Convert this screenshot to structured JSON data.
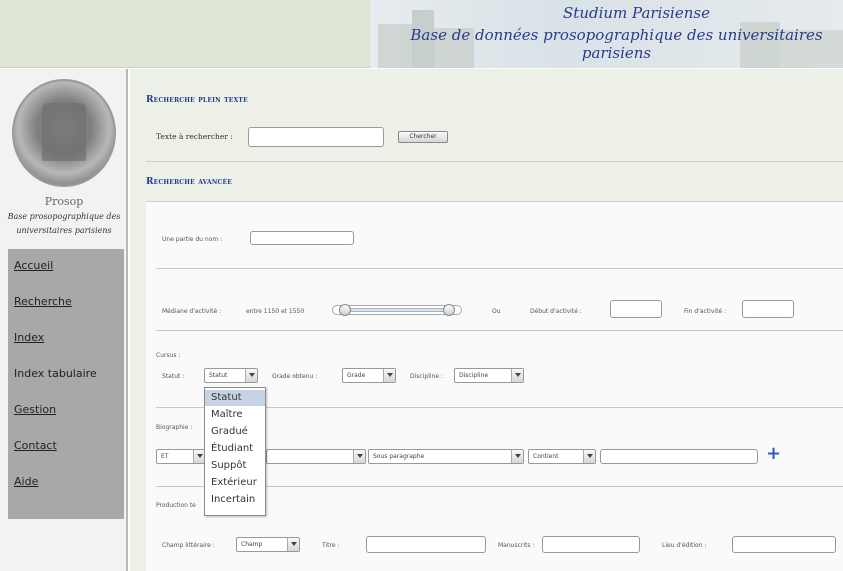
{
  "header": {
    "title": "Studium Parisiense",
    "subtitle": "Base de données prosopographique des universitaires parisiens"
  },
  "sidebar": {
    "seal_text": "Prosop",
    "description": "Base prosopographique des universitaires parisiens",
    "nav": [
      {
        "label": "Accueil"
      },
      {
        "label": "Recherche"
      },
      {
        "label": "Index"
      },
      {
        "label": "Index tabulaire"
      },
      {
        "label": "Gestion"
      },
      {
        "label": "Contact"
      },
      {
        "label": "Aide"
      }
    ]
  },
  "fulltext": {
    "title": "Recherche plein texte",
    "label": "Texte à rechercher :",
    "button": "Chercher"
  },
  "advanced": {
    "title": "Recherche avancée",
    "name_label": "Une partie du nom :",
    "median_label": "Médiane d'activité :",
    "median_range": "entre 1150 et 1550",
    "or_label": "Ou",
    "start_label": "Début d'activité :",
    "end_label": "Fin d'activité :",
    "cursus_label": "Cursus :",
    "statut_label": "Statut :",
    "statut_value": "Statut",
    "grade_label": "Grade obtenu :",
    "grade_value": "Grade",
    "discipline_label": "Discipline :",
    "discipline_value": "Discipline",
    "bio_label": "Biographie :",
    "bio_op": "ET",
    "bio_sub": "Sous paragraphe",
    "bio_cond": "Contient",
    "production_label": "Production te",
    "champ_label": "Champ littéraire :",
    "champ_value": "Champ",
    "titre_label": "Titre :",
    "manuscrits_label": "Manuscrits :",
    "lieu_label": "Lieu d'édition :"
  },
  "statut_dropdown": {
    "options": [
      "Statut",
      "Maître",
      "Gradué",
      "Étudiant",
      "Suppôt",
      "Extérieur",
      "Incertain"
    ],
    "selected": "Statut",
    "highlight_color": "#c6d3e3"
  },
  "colors": {
    "accent": "#1f3c8a",
    "header_bg": "#dfe6d8",
    "main_bg": "#ecf0e6",
    "nav_bg": "#a8a8a8"
  }
}
